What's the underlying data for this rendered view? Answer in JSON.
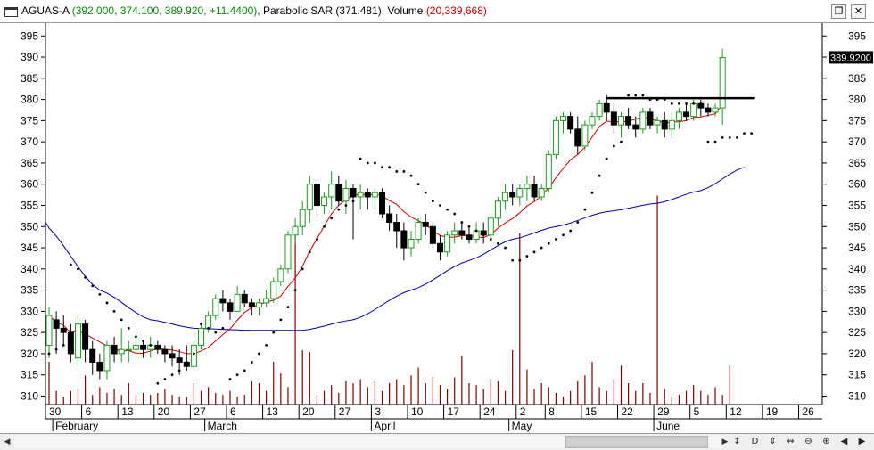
{
  "window": {
    "symbol": "AGUAS-A",
    "ohlc_text": "(392.000, 374.100, 389.920, +11.4400)",
    "sar_label": "Parabolic SAR",
    "sar_value": "(371.481)",
    "volume_label": "Volume",
    "volume_value": "(20,339,668)",
    "restore_icon": "restore-icon",
    "close_icon": "close-icon"
  },
  "colors": {
    "up": "#1f9a1f",
    "down": "#000000",
    "ma_short": "#d00000",
    "ma_long": "#0000b0",
    "volume": "#800000",
    "sar": "#000000",
    "grid_bg": "#ffffff"
  },
  "toolbar": {
    "icons": [
      "refresh-icon",
      "daily-icon",
      "pan-vertical-icon",
      "pan-horizontal-icon",
      "zoom-out-icon",
      "zoom-in-icon",
      "scroll-left-icon",
      "scroll-right-icon"
    ],
    "glyphs": [
      "↕",
      "D",
      "⇕",
      "⇔",
      "⊖",
      "⊕",
      "◀",
      "▶"
    ]
  },
  "chart_data": {
    "type": "candlestick",
    "ylim": [
      308,
      398
    ],
    "yticks": [
      310,
      315,
      320,
      325,
      330,
      335,
      340,
      345,
      350,
      355,
      360,
      365,
      370,
      375,
      380,
      385,
      390,
      395
    ],
    "last_price_label": "389.9200",
    "last_price": 389.92,
    "resistance_level": 380.3,
    "x_day_labels": [
      "30",
      "6",
      "13",
      "20",
      "27",
      "6",
      "13",
      "20",
      "27",
      "3",
      "10",
      "17",
      "24",
      "2",
      "8",
      "15",
      "22",
      "29",
      "5",
      "12",
      "19",
      "26"
    ],
    "x_day_index": [
      0,
      5,
      10,
      15,
      20,
      25,
      30,
      35,
      40,
      45,
      50,
      55,
      60,
      65,
      69,
      74,
      79,
      84,
      89,
      94,
      99,
      104
    ],
    "month_labels": [
      "February",
      "March",
      "April",
      "May",
      "June"
    ],
    "month_index": [
      1,
      22,
      45,
      64,
      84
    ],
    "candles": [
      [
        322,
        331,
        319,
        329
      ],
      [
        328,
        330,
        320,
        326
      ],
      [
        326,
        329,
        322,
        325
      ],
      [
        325,
        327,
        318,
        320
      ],
      [
        319,
        329,
        317,
        327
      ],
      [
        327,
        328,
        318,
        321
      ],
      [
        321,
        323,
        315,
        318
      ],
      [
        318,
        320,
        314,
        316
      ],
      [
        316,
        323,
        314,
        322
      ],
      [
        322,
        324,
        318,
        320
      ],
      [
        320,
        326,
        318,
        321
      ],
      [
        321,
        323,
        318,
        321
      ],
      [
        321,
        325,
        319,
        322
      ],
      [
        322,
        323,
        319,
        321
      ],
      [
        321,
        324,
        319,
        322
      ],
      [
        322,
        323,
        320,
        321
      ],
      [
        321,
        322,
        318,
        320
      ],
      [
        320,
        322,
        317,
        319
      ],
      [
        319,
        321,
        315,
        318
      ],
      [
        318,
        322,
        316,
        317
      ],
      [
        317,
        323,
        316,
        322
      ],
      [
        322,
        327,
        321,
        326
      ],
      [
        326,
        330,
        325,
        329
      ],
      [
        329,
        334,
        328,
        333
      ],
      [
        333,
        335,
        330,
        332
      ],
      [
        332,
        333,
        328,
        330
      ],
      [
        330,
        336,
        330,
        334
      ],
      [
        334,
        335,
        331,
        332
      ],
      [
        332,
        333,
        329,
        331
      ],
      [
        331,
        333,
        329,
        332
      ],
      [
        332,
        335,
        331,
        333
      ],
      [
        333,
        338,
        332,
        337
      ],
      [
        337,
        341,
        336,
        340
      ],
      [
        340,
        349,
        339,
        348
      ],
      [
        348,
        352,
        346,
        350
      ],
      [
        350,
        356,
        348,
        354
      ],
      [
        354,
        362,
        351,
        360
      ],
      [
        360,
        361,
        352,
        355
      ],
      [
        355,
        358,
        353,
        357
      ],
      [
        357,
        363,
        354,
        360
      ],
      [
        360,
        362,
        355,
        356
      ],
      [
        356,
        361,
        353,
        359
      ],
      [
        359,
        360,
        347,
        357
      ],
      [
        357,
        360,
        354,
        358
      ],
      [
        358,
        359,
        354,
        357
      ],
      [
        357,
        359,
        354,
        358
      ],
      [
        358,
        359,
        352,
        353
      ],
      [
        353,
        355,
        349,
        351
      ],
      [
        351,
        353,
        345,
        349
      ],
      [
        349,
        351,
        342,
        345
      ],
      [
        345,
        349,
        343,
        347
      ],
      [
        347,
        352,
        346,
        351
      ],
      [
        351,
        353,
        348,
        350
      ],
      [
        350,
        351,
        345,
        346
      ],
      [
        346,
        348,
        342,
        344
      ],
      [
        344,
        349,
        343,
        348
      ],
      [
        348,
        351,
        346,
        349
      ],
      [
        349,
        351,
        347,
        348
      ],
      [
        348,
        350,
        346,
        347
      ],
      [
        347,
        351,
        346,
        349
      ],
      [
        349,
        351,
        346,
        348
      ],
      [
        348,
        353,
        347,
        352
      ],
      [
        352,
        357,
        350,
        356
      ],
      [
        356,
        360,
        354,
        358
      ],
      [
        358,
        360,
        355,
        357
      ],
      [
        357,
        360,
        355,
        359
      ],
      [
        359,
        362,
        356,
        360
      ],
      [
        360,
        362,
        356,
        357
      ],
      [
        357,
        360,
        356,
        359
      ],
      [
        359,
        368,
        358,
        367
      ],
      [
        367,
        376,
        366,
        375
      ],
      [
        375,
        377,
        372,
        376
      ],
      [
        376,
        377,
        372,
        373
      ],
      [
        373,
        376,
        367,
        369
      ],
      [
        369,
        375,
        368,
        374
      ],
      [
        374,
        377,
        373,
        376
      ],
      [
        376,
        380,
        375,
        379
      ],
      [
        379,
        381,
        375,
        377
      ],
      [
        377,
        379,
        372,
        374
      ],
      [
        374,
        377,
        371,
        376
      ],
      [
        376,
        378,
        373,
        374
      ],
      [
        374,
        376,
        371,
        373
      ],
      [
        373,
        378,
        372,
        377
      ],
      [
        377,
        378,
        373,
        374
      ],
      [
        374,
        376,
        372,
        375
      ],
      [
        375,
        377,
        371,
        373
      ],
      [
        373,
        377,
        371,
        375
      ],
      [
        375,
        378,
        373,
        377
      ],
      [
        377,
        379,
        375,
        376
      ],
      [
        376,
        380,
        375,
        379
      ],
      [
        379,
        380,
        376,
        378
      ],
      [
        378,
        379,
        376,
        377
      ],
      [
        377,
        379,
        376,
        378
      ],
      [
        378,
        392,
        374,
        389.92
      ]
    ],
    "volume": [
      22,
      7,
      4,
      7,
      8,
      15,
      5,
      9,
      6,
      8,
      5,
      11,
      5,
      6,
      5,
      6,
      8,
      5,
      4,
      4,
      11,
      7,
      9,
      6,
      5,
      7,
      4,
      5,
      12,
      11,
      7,
      22,
      16,
      9,
      42,
      28,
      27,
      5,
      7,
      10,
      6,
      12,
      11,
      13,
      9,
      12,
      7,
      11,
      13,
      10,
      15,
      19,
      11,
      14,
      10,
      8,
      14,
      25,
      11,
      10,
      8,
      13,
      12,
      7,
      28,
      41,
      18,
      8,
      11,
      9,
      6,
      4,
      7,
      12,
      15,
      22,
      9,
      7,
      13,
      20,
      11,
      7,
      11,
      6,
      50,
      8,
      4,
      5,
      7,
      10,
      7,
      5,
      9,
      5,
      20
    ],
    "sar": [
      320,
      321,
      322,
      341,
      340,
      338,
      336,
      334,
      332,
      330,
      328,
      326,
      324,
      323,
      322,
      313,
      314,
      315,
      316,
      318,
      320,
      327,
      326,
      325,
      326,
      314,
      315,
      316,
      318,
      320,
      322,
      325,
      328,
      331,
      335,
      340,
      344,
      347,
      350,
      352,
      354,
      355,
      356,
      366,
      365,
      365,
      364,
      364,
      363,
      363,
      362,
      360,
      358,
      356,
      355,
      354,
      353,
      351,
      350,
      349,
      348,
      347,
      346,
      345,
      342,
      342,
      343,
      344,
      345,
      346,
      347,
      348,
      349,
      351,
      354,
      358,
      362,
      366,
      369,
      370,
      381,
      381,
      381,
      380,
      380,
      380,
      379,
      379,
      379,
      379,
      379,
      370,
      370,
      371,
      371,
      371,
      372,
      372
    ]
  }
}
